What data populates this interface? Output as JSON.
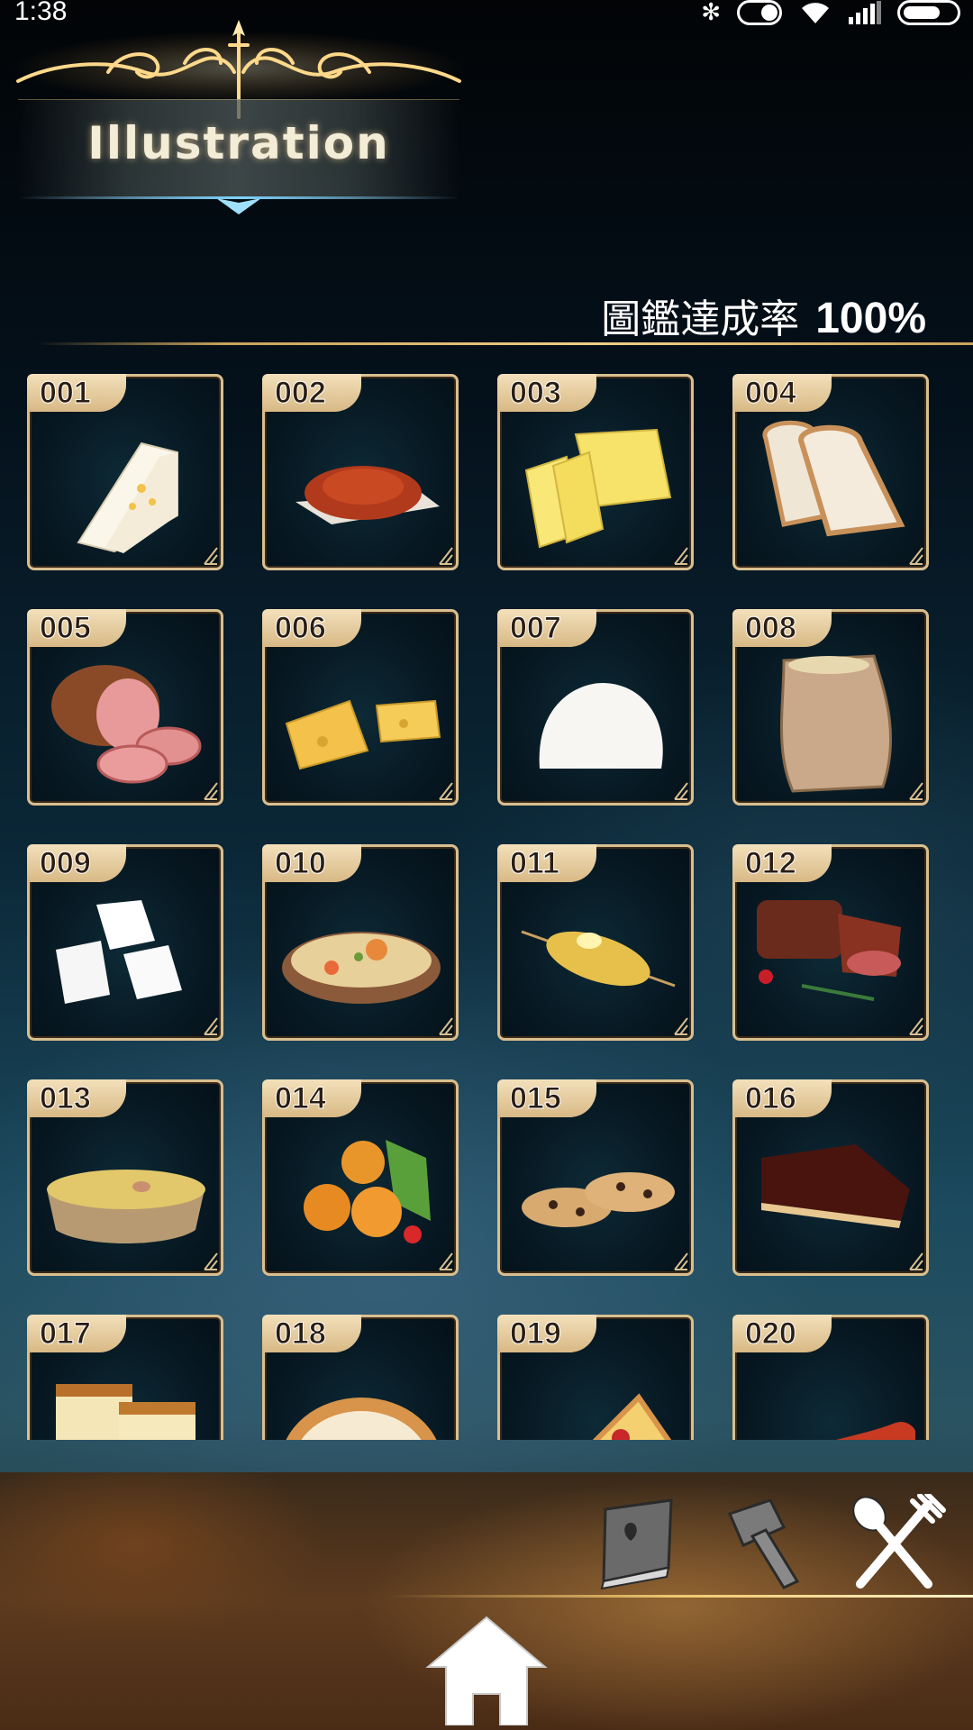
{
  "status_bar": {
    "time": "1:38"
  },
  "header": {
    "title": "Illustration"
  },
  "completion": {
    "label": "圖鑑達成率",
    "value": "100%"
  },
  "cards": [
    {
      "number": "001",
      "food": "sandwich"
    },
    {
      "number": "002",
      "food": "chili-powder"
    },
    {
      "number": "003",
      "food": "butter"
    },
    {
      "number": "004",
      "food": "bread-slices"
    },
    {
      "number": "005",
      "food": "ham"
    },
    {
      "number": "006",
      "food": "cheese"
    },
    {
      "number": "007",
      "food": "dough"
    },
    {
      "number": "008",
      "food": "flour-sack"
    },
    {
      "number": "009",
      "food": "sugar-cubes"
    },
    {
      "number": "010",
      "food": "stew"
    },
    {
      "number": "011",
      "food": "grilled-corn"
    },
    {
      "number": "012",
      "food": "steak"
    },
    {
      "number": "013",
      "food": "soup"
    },
    {
      "number": "014",
      "food": "fried-chicken"
    },
    {
      "number": "015",
      "food": "cookies"
    },
    {
      "number": "016",
      "food": "chocolate-cake"
    },
    {
      "number": "017",
      "food": "castella"
    },
    {
      "number": "018",
      "food": "pie"
    },
    {
      "number": "019",
      "food": "pizza"
    },
    {
      "number": "020",
      "food": "sausage"
    }
  ],
  "nav": {
    "illustration_book_icon": "book-icon",
    "craft_icon": "hammer-icon",
    "cook_icon": "utensils-icon",
    "home_icon": "home-icon"
  }
}
